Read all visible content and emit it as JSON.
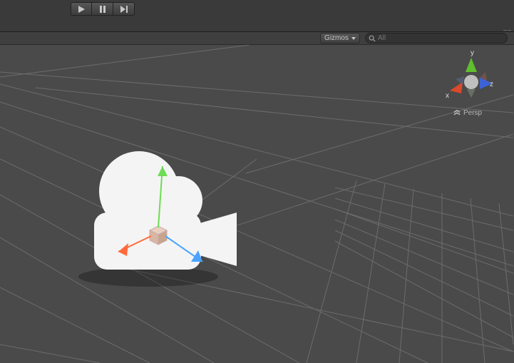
{
  "playback": {
    "play_icon": "play",
    "pause_icon": "pause",
    "step_icon": "step"
  },
  "scenebar": {
    "gizmos_label": "Gizmos",
    "search_placeholder": "All",
    "search_value": ""
  },
  "orientation": {
    "y_label": "y",
    "x_label": "x",
    "z_label": "z",
    "projection_label": "Persp"
  }
}
